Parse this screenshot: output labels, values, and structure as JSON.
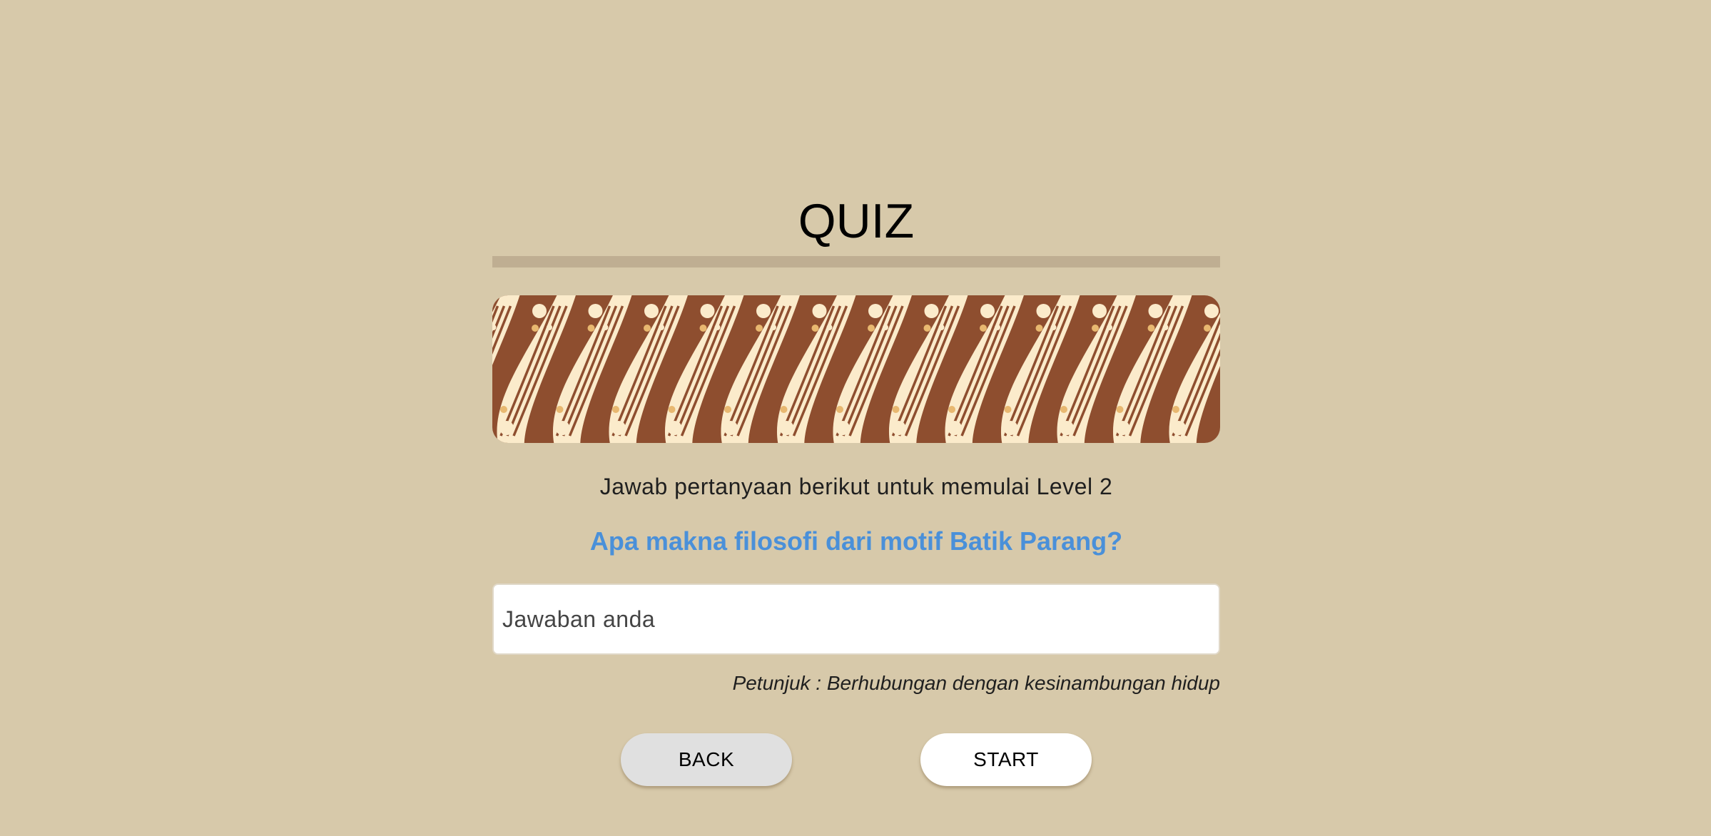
{
  "quiz": {
    "title": "QUIZ",
    "instruction": "Jawab pertanyaan berikut untuk memulai Level 2",
    "question": "Apa makna filosofi dari motif Batik Parang?",
    "answer_placeholder": "Jawaban anda",
    "answer_value": "",
    "hint": "Petunjuk : Berhubungan dengan kesinambungan hidup"
  },
  "buttons": {
    "back_label": "BACK",
    "start_label": "START"
  },
  "banner": {
    "pattern": "batik-parang",
    "colors": {
      "background": "#8e4e2f",
      "motif": "#fbebcb",
      "accent": "#e8b870"
    }
  },
  "colors": {
    "page_background": "#d7c9aa",
    "divider": "#bfae92",
    "question": "#4a90d9"
  }
}
